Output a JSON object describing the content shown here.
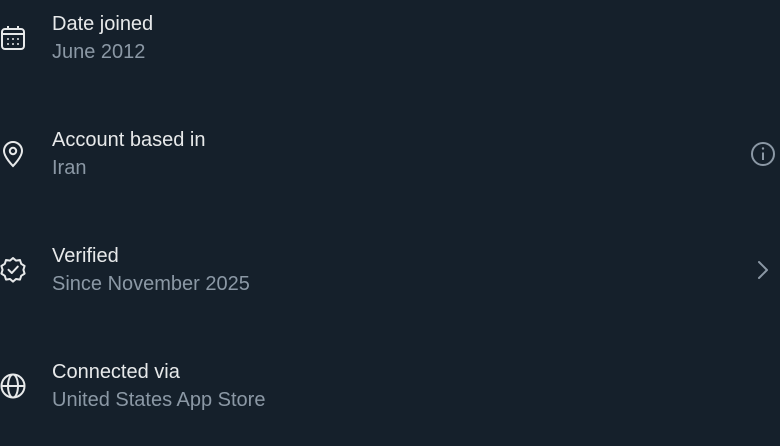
{
  "details": [
    {
      "icon": "calendar-icon",
      "title": "Date joined",
      "value": "June 2012"
    },
    {
      "icon": "location-pin-icon",
      "title": "Account based in",
      "value": "Iran",
      "trailing_icon": "info-icon"
    },
    {
      "icon": "verified-badge-icon",
      "title": "Verified",
      "value": "Since November 2025",
      "trailing_icon": "chevron-right-icon"
    },
    {
      "icon": "globe-icon",
      "title": "Connected via",
      "value": "United States App Store"
    }
  ],
  "colors": {
    "background": "#15202b",
    "primary_text": "#e7e9ea",
    "secondary_text": "#8b98a5"
  }
}
